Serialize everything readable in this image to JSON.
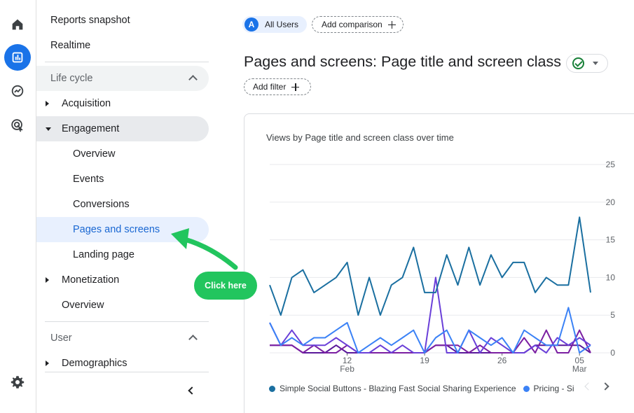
{
  "rail": {
    "items": [
      {
        "name": "home-icon",
        "active": false
      },
      {
        "name": "reports-icon",
        "active": true
      },
      {
        "name": "explore-icon",
        "active": false
      },
      {
        "name": "advertising-icon",
        "active": false
      }
    ],
    "settings_icon": "settings-icon"
  },
  "nav": {
    "reports_snapshot": "Reports snapshot",
    "realtime": "Realtime",
    "lifecycle": "Life cycle",
    "acquisition": "Acquisition",
    "engagement": "Engagement",
    "engagement_items": {
      "overview": "Overview",
      "events": "Events",
      "conversions": "Conversions",
      "pages_and_screens": "Pages and screens",
      "landing_page": "Landing page"
    },
    "monetization": "Monetization",
    "monetization_overview": "Overview",
    "user": "User",
    "demographics": "Demographics"
  },
  "header": {
    "all_users": "All Users",
    "avatar_letter": "A",
    "add_comparison": "Add comparison",
    "page_title": "Pages and screens: Page title and screen class",
    "add_filter": "Add filter"
  },
  "annotation": {
    "click_here": "Click here"
  },
  "colors": {
    "series1": "#1a6fa0",
    "series2": "#3b82f6",
    "series3": "#6a3fd8",
    "series4": "#7b1fa2",
    "series5": "#5a189a",
    "accent": "#1a73e8",
    "annotation": "#22c55e"
  },
  "chart_data": {
    "type": "line",
    "title": "Views by Page title and screen class over time",
    "x_tick_labels": [
      {
        "day": "12",
        "month": "Feb"
      },
      {
        "day": "19",
        "month": ""
      },
      {
        "day": "26",
        "month": ""
      },
      {
        "day": "05",
        "month": "Mar"
      }
    ],
    "x_tick_indices": [
      7,
      14,
      21,
      28
    ],
    "y_ticks": [
      0,
      5,
      10,
      15,
      20,
      25
    ],
    "ylim": [
      0,
      25
    ],
    "series": [
      {
        "name": "Simple Social Buttons - Blazing Fast Social Sharing Experience",
        "values": [
          9,
          5,
          10,
          11,
          8,
          9,
          10,
          12,
          5,
          10,
          5,
          9,
          10,
          14,
          8,
          8,
          13,
          9,
          14,
          9,
          13,
          10,
          12,
          12,
          8,
          10,
          9,
          9,
          18,
          8
        ]
      },
      {
        "name": "Pricing - Si",
        "values": [
          4,
          1,
          2,
          1,
          2,
          2,
          3,
          4,
          0,
          1,
          2,
          1,
          2,
          3,
          0,
          2,
          3,
          0,
          3,
          2,
          1,
          2,
          0,
          3,
          2,
          1,
          1,
          6,
          0,
          1
        ]
      },
      {
        "values": [
          4,
          1,
          3,
          1,
          1,
          1,
          2,
          1,
          0,
          0,
          1,
          0,
          1,
          0,
          0,
          10,
          0,
          0,
          3,
          0,
          2,
          1,
          0,
          0,
          1,
          0,
          2,
          1,
          2,
          1
        ]
      },
      {
        "values": [
          1,
          1,
          1,
          0,
          1,
          0,
          0,
          1,
          0,
          0,
          0,
          0,
          0,
          0,
          0,
          1,
          1,
          1,
          0,
          1,
          0,
          0,
          0,
          2,
          0,
          3,
          0,
          0,
          3,
          0
        ]
      },
      {
        "values": [
          1,
          1,
          1,
          0,
          0,
          0,
          1,
          0,
          0,
          0,
          0,
          0,
          0,
          0,
          0,
          1,
          1,
          0,
          0,
          0,
          0,
          0,
          0,
          0,
          1,
          1,
          1,
          1,
          1,
          0
        ]
      }
    ],
    "legend_position": "bottom",
    "grid": true
  }
}
